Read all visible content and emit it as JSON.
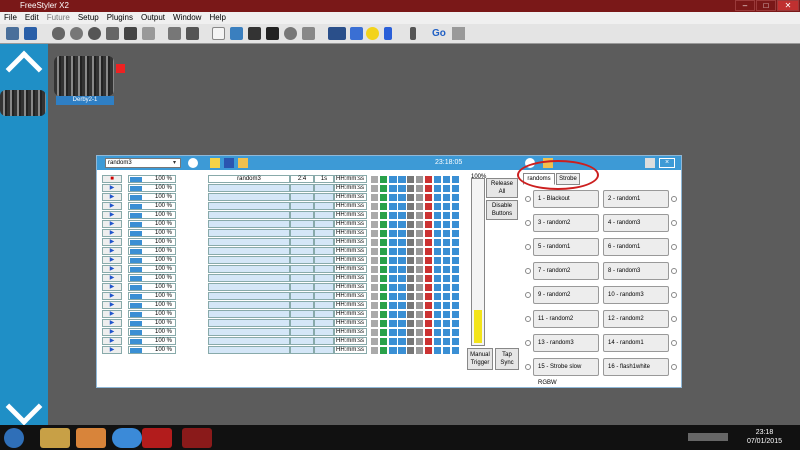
{
  "window": {
    "title": "FreeStyler X2"
  },
  "menu": [
    "File",
    "Edit",
    "Future",
    "Setup",
    "Plugins",
    "Output",
    "Window",
    "Help"
  ],
  "toolbar": {
    "go_label": "Go"
  },
  "fixture": {
    "label": "Derby2-1"
  },
  "cuelist": {
    "selected": "random3",
    "time": "23:18:05",
    "volume_label": "100%",
    "volume_level": 0.2,
    "buttons": {
      "release_all": "Release All",
      "disable_buttons": "Disable Buttons",
      "manual_trigger": "Manual Trigger",
      "tap_sync": "Tap Sync"
    },
    "first_row": {
      "name": "random3",
      "col2": "2:4",
      "col3": "1s"
    },
    "rows": [
      {
        "level": "100 %",
        "time": "HH:mm:ss"
      },
      {
        "level": "100 %",
        "time": "HH:mm:ss"
      },
      {
        "level": "100 %",
        "time": "HH:mm:ss"
      },
      {
        "level": "100 %",
        "time": "HH:mm:ss"
      },
      {
        "level": "100 %",
        "time": "HH:mm:ss"
      },
      {
        "level": "100 %",
        "time": "HH:mm:ss"
      },
      {
        "level": "100 %",
        "time": "HH:mm:ss"
      },
      {
        "level": "100 %",
        "time": "HH:mm:ss"
      },
      {
        "level": "100 %",
        "time": "HH:mm:ss"
      },
      {
        "level": "100 %",
        "time": "HH:mm:ss"
      },
      {
        "level": "100 %",
        "time": "HH:mm:ss"
      },
      {
        "level": "100 %",
        "time": "HH:mm:ss"
      },
      {
        "level": "100 %",
        "time": "HH:mm:ss"
      },
      {
        "level": "100 %",
        "time": "HH:mm:ss"
      },
      {
        "level": "100 %",
        "time": "HH:mm:ss"
      },
      {
        "level": "100 %",
        "time": "HH:mm:ss"
      },
      {
        "level": "100 %",
        "time": "HH:mm:ss"
      },
      {
        "level": "100 %",
        "time": "HH:mm:ss"
      },
      {
        "level": "100 %",
        "time": "HH:mm:ss"
      },
      {
        "level": "100 %",
        "time": "HH:mm:ss"
      }
    ],
    "tabs": [
      "randoms",
      "Strobe"
    ],
    "active_tab": "randoms",
    "function_buttons": [
      "1 - Blackout",
      "2 - random1",
      "3 - random2",
      "4 - random3",
      "5 - random1",
      "6 - random1",
      "7 - random2",
      "8 - random3",
      "9 - random2",
      "10 - random3",
      "11 - random2",
      "12 - random2",
      "13 - random3",
      "14 - random1",
      "15 - Strobe slow RGBW",
      "16 - flash1white"
    ]
  },
  "taskbar": {
    "time": "23:18",
    "date": "07/01/2015"
  },
  "colors": {
    "sidebar": "#1f8fc6",
    "titlebar": "#7a1818",
    "header": "#3d9ad6",
    "highlight_circle": "#cc1f1f",
    "volume_fill": "#f3e41a"
  }
}
